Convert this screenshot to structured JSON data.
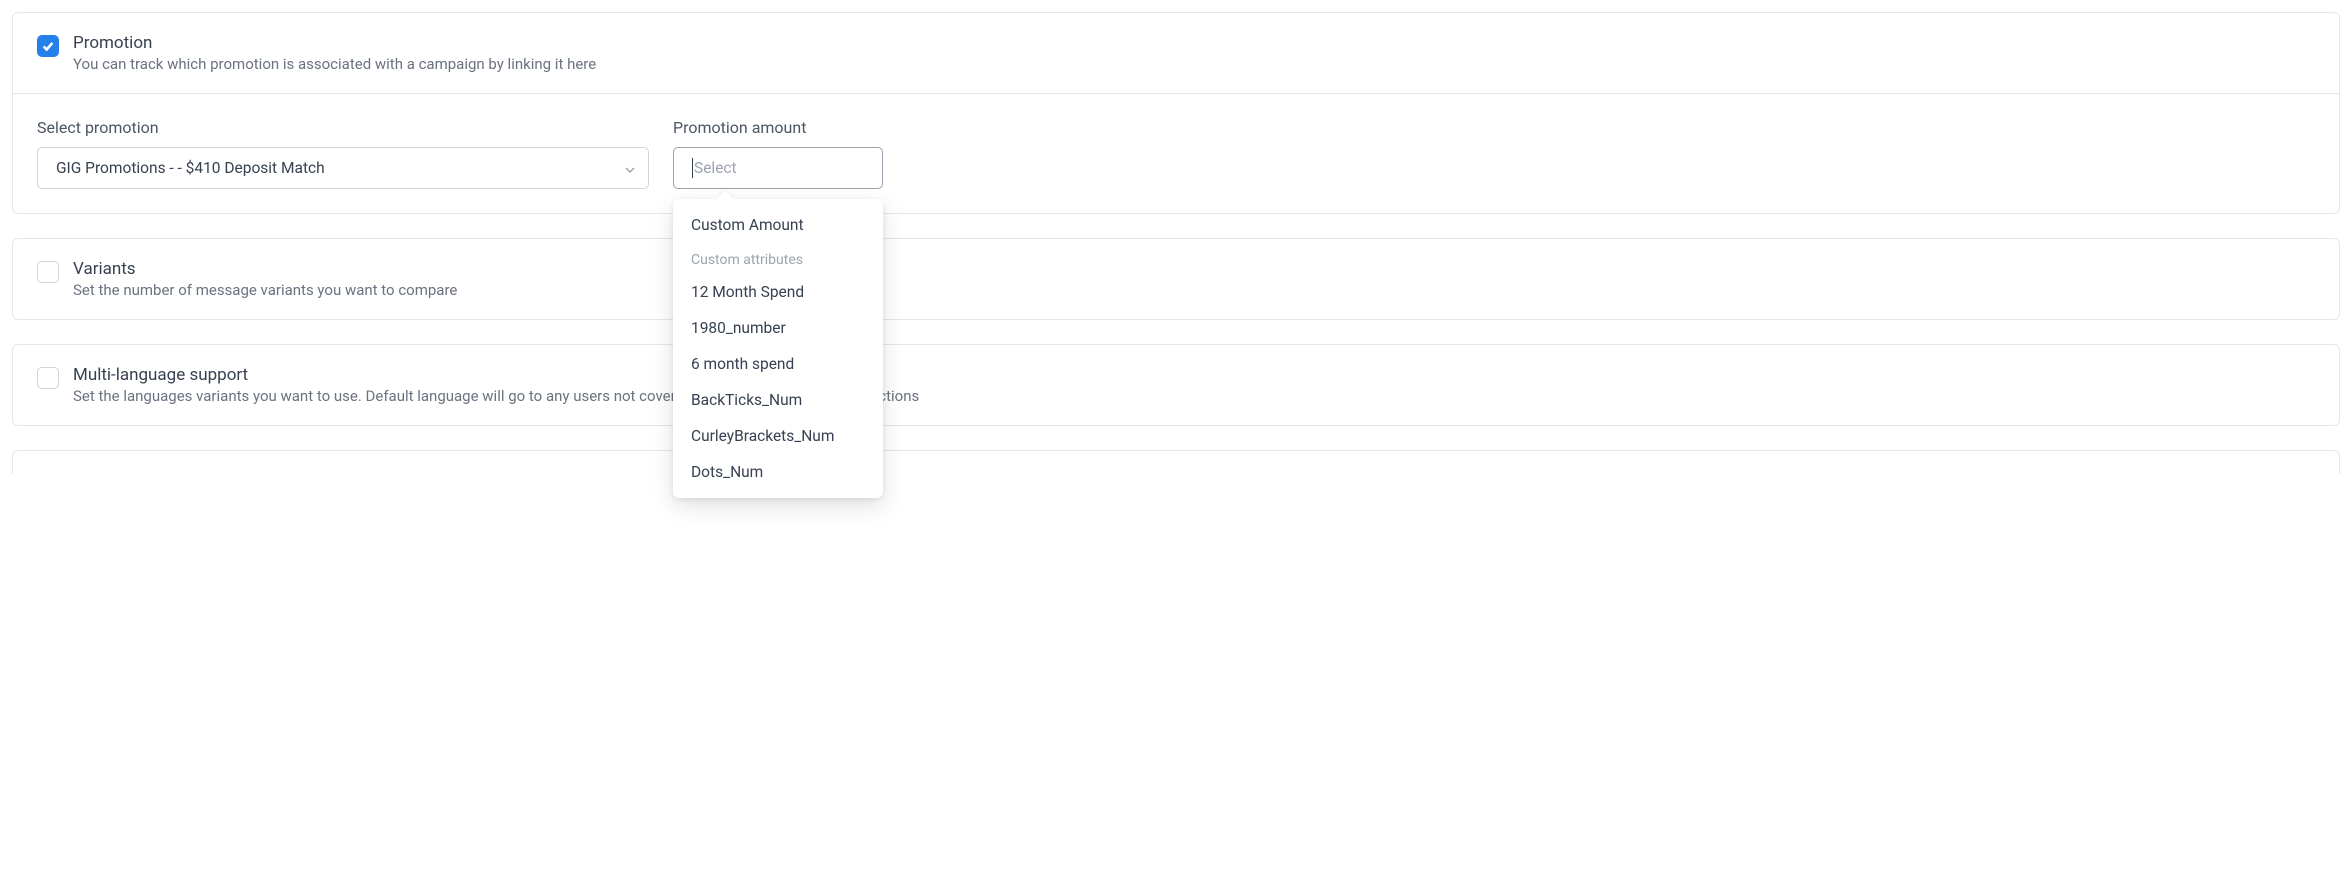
{
  "promotion": {
    "title": "Promotion",
    "subtitle": "You can track which promotion is associated with a campaign by linking it here",
    "checked": true,
    "select_label": "Select promotion",
    "select_value": "GIG Promotions -  - $410 Deposit Match",
    "amount_label": "Promotion amount",
    "amount_placeholder": "Select"
  },
  "dropdown": {
    "item_custom": "Custom Amount",
    "group_label": "Custom attributes",
    "items": [
      "12 Month Spend",
      "1980_number",
      "6 month spend",
      "BackTicks_Num",
      "CurleyBrackets_Num",
      "Dots_Num"
    ]
  },
  "variants": {
    "title": "Variants",
    "subtitle": "Set the number of message variants you want to compare",
    "checked": false
  },
  "multilang": {
    "title": "Multi-language support",
    "subtitle": "Set the languages variants you want to use. Default language will go to any users not covered by your other language selections",
    "checked": false
  }
}
